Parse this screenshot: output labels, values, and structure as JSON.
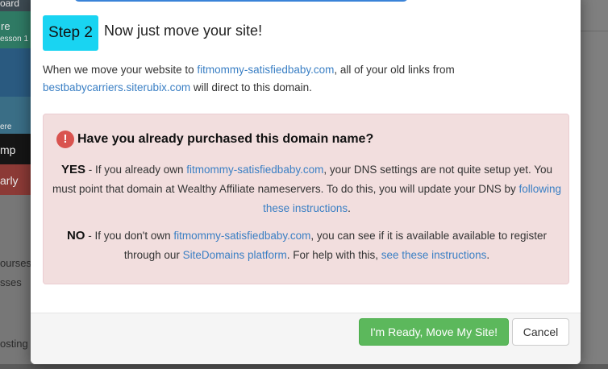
{
  "background": {
    "sidebar_tiles": [
      "oard",
      "re",
      "esson 1",
      "ere",
      "mp",
      "arly"
    ],
    "sidebar_text": [
      "ourses",
      "sses",
      "osting"
    ]
  },
  "modal": {
    "step_badge": "Step 2",
    "step_title": "Now just move your site!",
    "intro": {
      "text1": "When we move your website to ",
      "link1": "fitmommy-satisfiedbaby.com",
      "text2": ", all of your old links from",
      "link2": "bestbabycarriers.siterubix.com",
      "text3": " will direct to this domain."
    },
    "alert": {
      "icon": "!",
      "title": "Have you already purchased this domain name?",
      "yes": {
        "lead": "YES",
        "text1": " - If you already own ",
        "link1": "fitmommy-satisfiedbaby.com",
        "text2": ", your DNS settings are not quite setup yet. You must point that domain at Wealthy Affiliate nameservers. To do this, you will update your DNS by ",
        "link2": "following these instructions",
        "text3": "."
      },
      "no": {
        "lead": "NO",
        "text1": " - If you don't own ",
        "link1": "fitmommy-satisfiedbaby.com",
        "text2": ", you can see if it is available available to register through our ",
        "link2": "SiteDomains platform",
        "text3": ". For help with this, ",
        "link3": "see these instructions",
        "text4": "."
      }
    },
    "buttons": {
      "ready": "I'm Ready, Move My Site!",
      "cancel": "Cancel"
    }
  },
  "colors": {
    "step_badge": "#19d4f2",
    "link": "#3a7fc4",
    "alert_bg": "#f2dede",
    "alert_icon": "#d9534f",
    "primary_button": "#5cb85c"
  }
}
